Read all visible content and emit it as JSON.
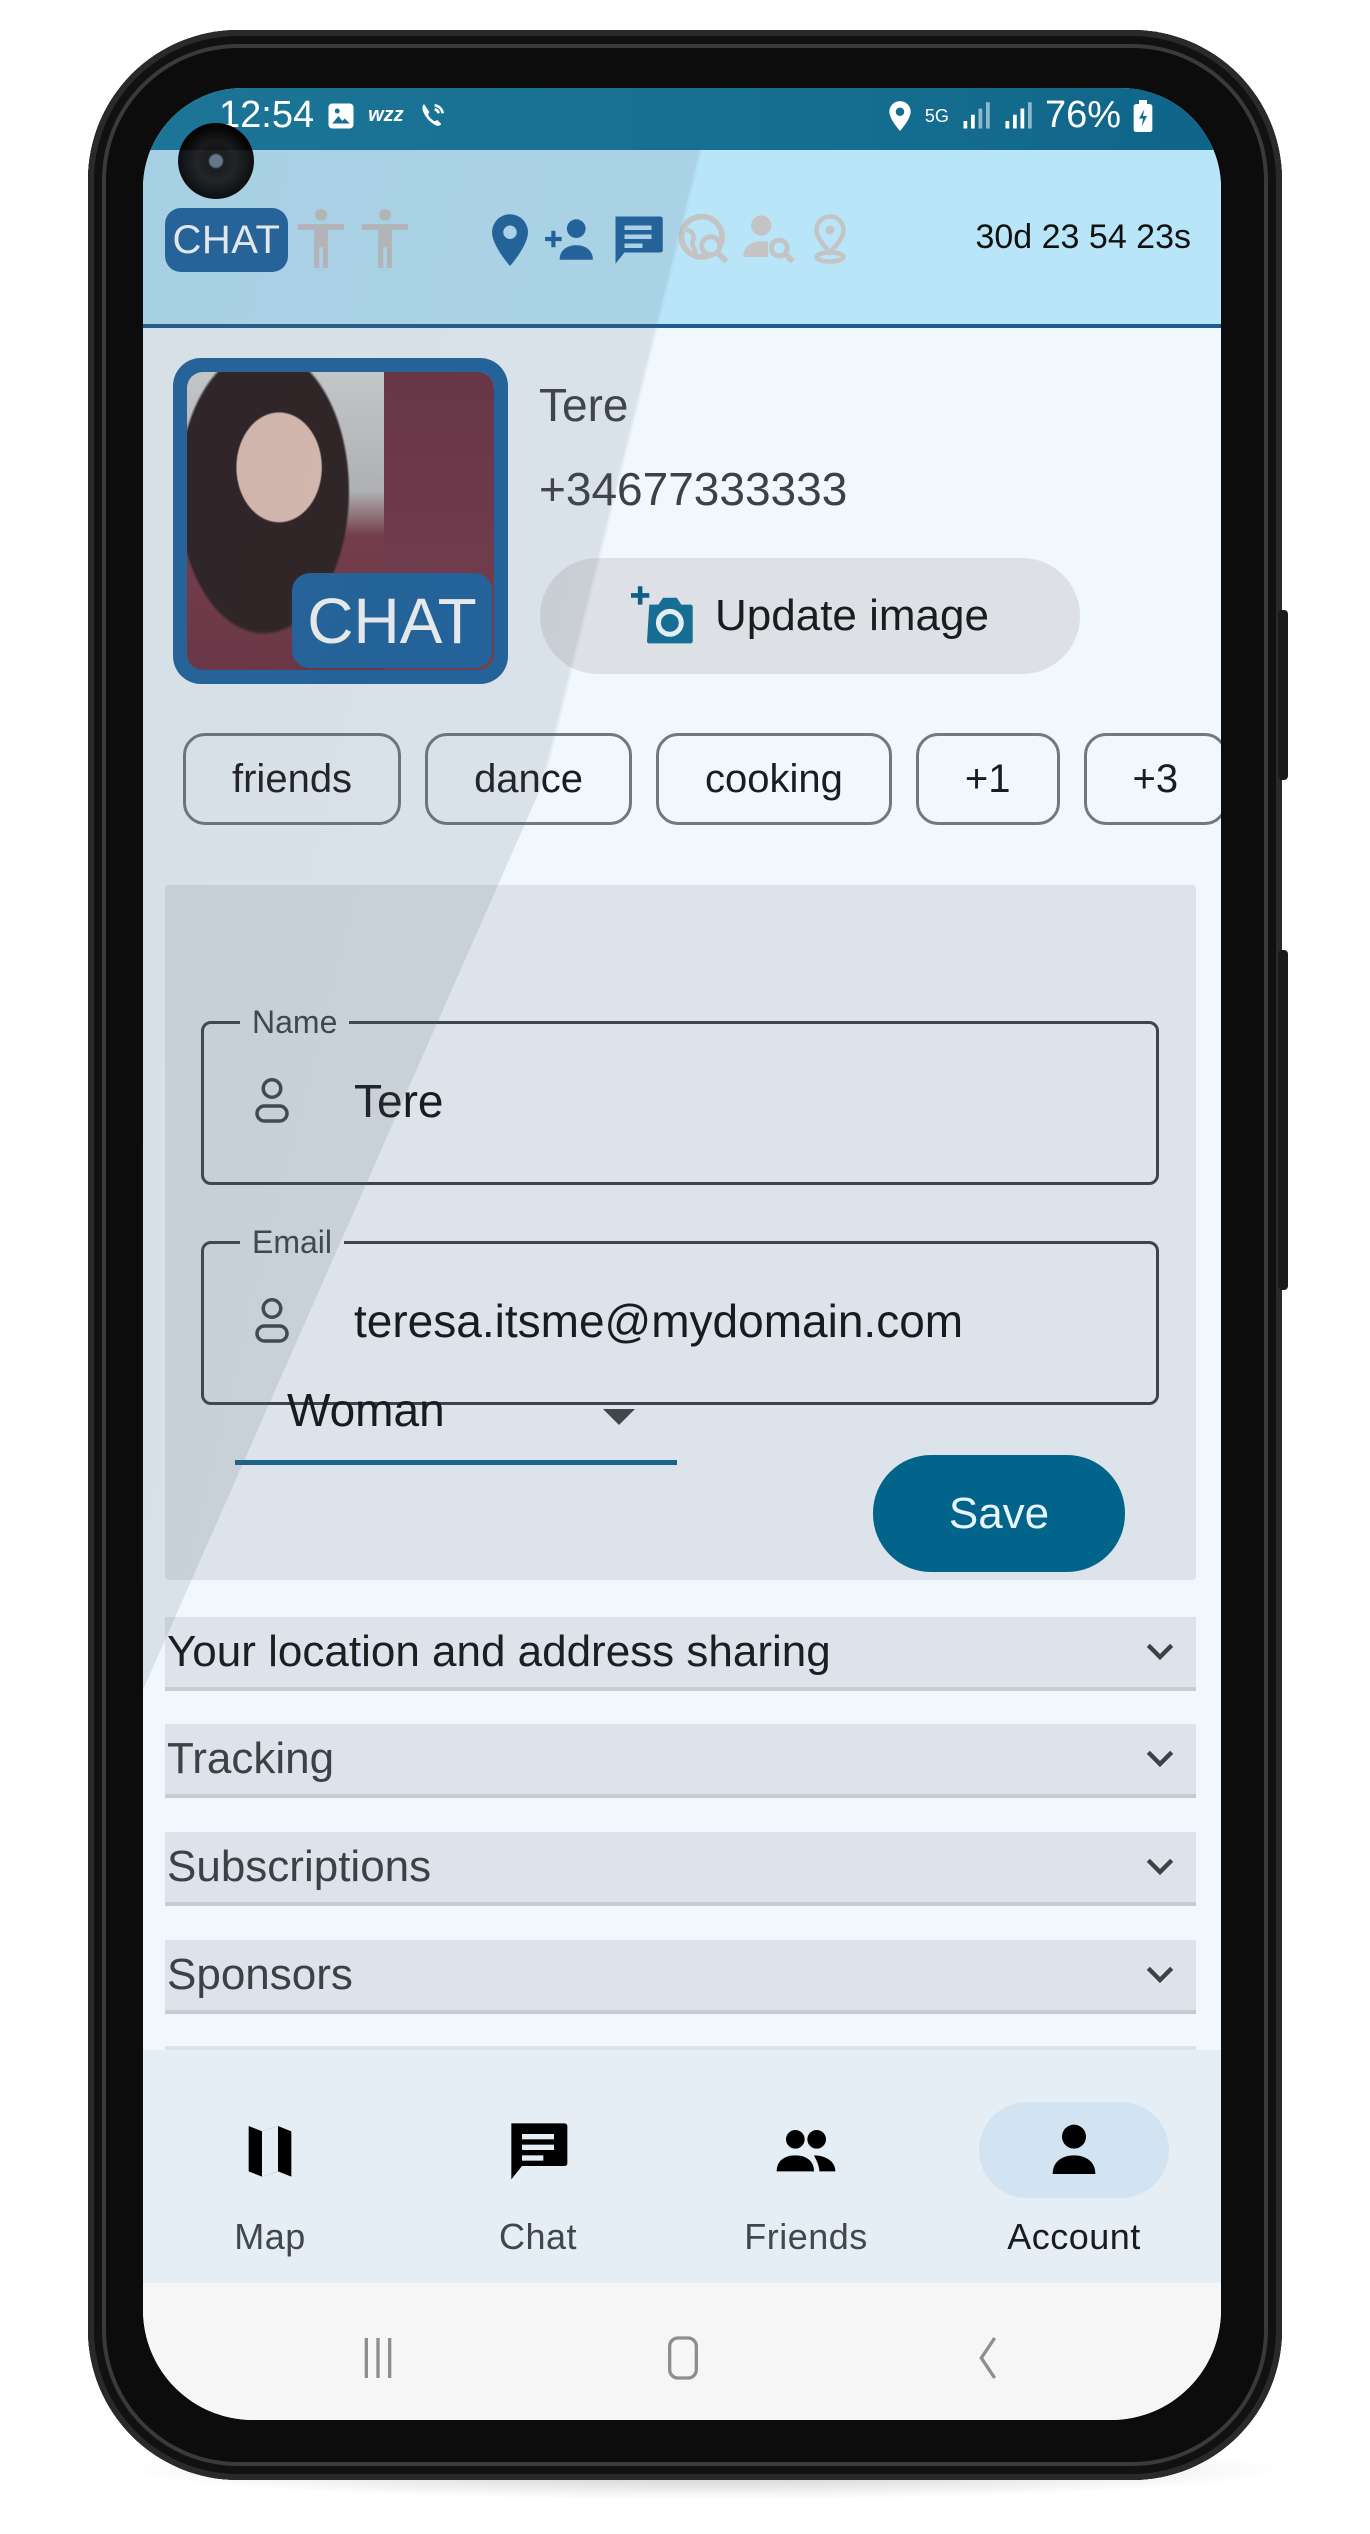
{
  "status_bar": {
    "time": "12:54",
    "left_icons": [
      "gallery-icon",
      "wzz-icon",
      "wifi-call-icon"
    ],
    "network": "5G",
    "battery": "76%"
  },
  "header": {
    "chat_badge": "CHAT",
    "toolbar_icons": [
      {
        "name": "person-standing-icon",
        "active": false
      },
      {
        "name": "person-standing-icon",
        "active": false
      },
      {
        "name": "location-pin-icon",
        "active": true
      },
      {
        "name": "add-person-icon",
        "active": true
      },
      {
        "name": "chat-message-icon",
        "active": true
      },
      {
        "name": "globe-search-icon",
        "active": false
      },
      {
        "name": "person-search-icon",
        "active": false
      },
      {
        "name": "location-outline-icon",
        "active": false
      }
    ],
    "timer": "30d 23 54 23s"
  },
  "profile": {
    "avatar_badge": "CHAT",
    "name": "Tere",
    "phone": "+34677333333",
    "update_image_label": "Update image"
  },
  "chips": [
    "friends",
    "dance",
    "cooking",
    "+1",
    "+3"
  ],
  "form": {
    "name_label": "Name",
    "name_value": "Tere",
    "email_label": "Email",
    "email_value": "teresa.itsme@mydomain.com",
    "gender_value": "Woman",
    "save_label": "Save"
  },
  "accordions": [
    {
      "title": "Your location and address sharing"
    },
    {
      "title": "Tracking"
    },
    {
      "title": "Subscriptions"
    },
    {
      "title": "Sponsors"
    }
  ],
  "bottom_nav": [
    {
      "label": "Map",
      "icon": "map-icon",
      "active": false
    },
    {
      "label": "Chat",
      "icon": "chat-icon",
      "active": false
    },
    {
      "label": "Friends",
      "icon": "friends-icon",
      "active": false
    },
    {
      "label": "Account",
      "icon": "account-icon",
      "active": true
    }
  ],
  "colors": {
    "primary": "#1d64a0",
    "accent": "#02648a",
    "header_bg": "#b9e5f9",
    "status_bar": "#166f91",
    "inactive_icon": "#c4c4c4",
    "form_panel": "#dce3ea",
    "page_bg": "#f0f8fd"
  }
}
